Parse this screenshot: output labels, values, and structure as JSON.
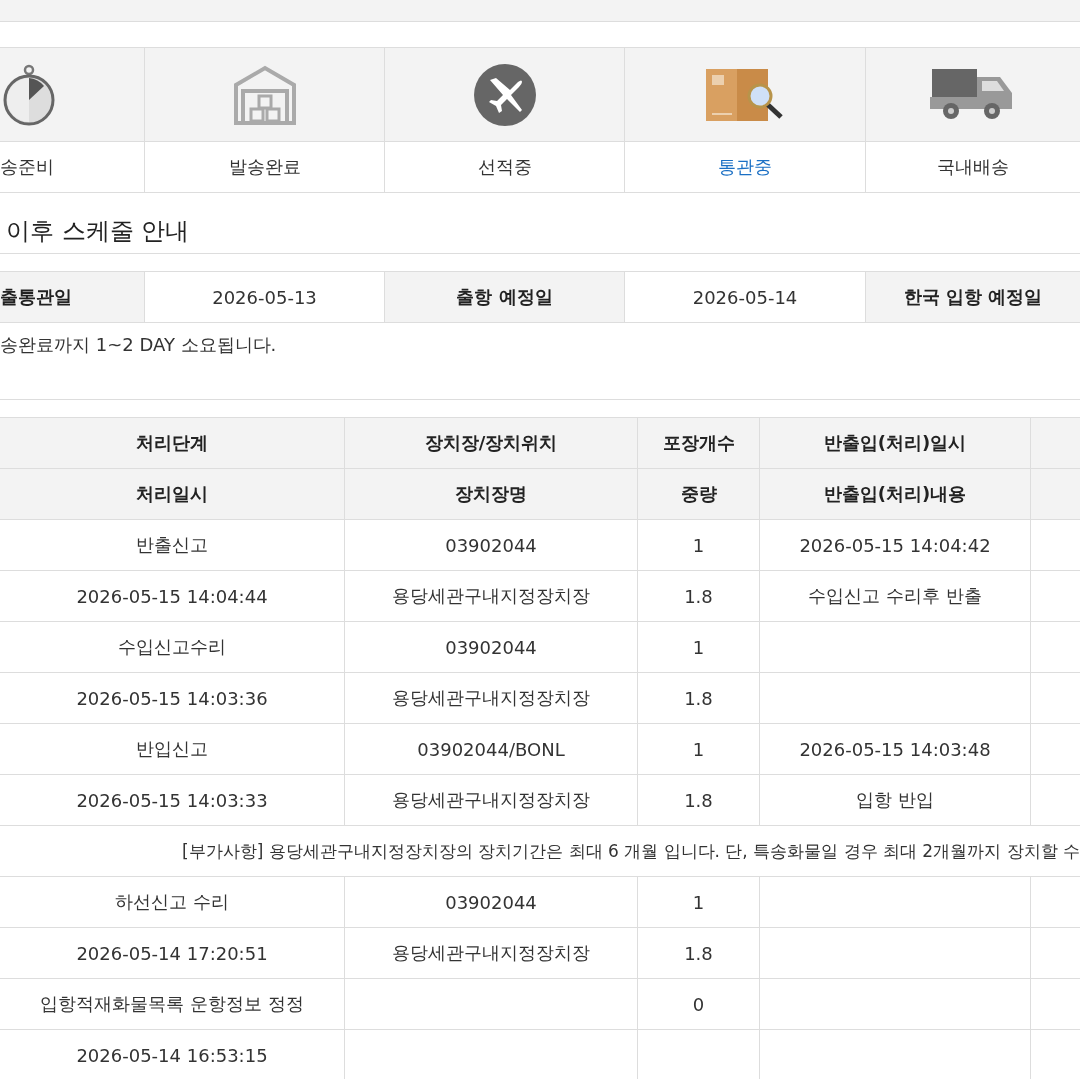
{
  "steps": [
    {
      "label": "송준비",
      "kind": "stopwatch",
      "selected": false
    },
    {
      "label": "발송완료",
      "kind": "warehouse",
      "selected": false
    },
    {
      "label": "선적중",
      "kind": "plane",
      "selected": false
    },
    {
      "label": "통관중",
      "kind": "inspection",
      "selected": true
    },
    {
      "label": "국내배송",
      "kind": "truck",
      "selected": false
    }
  ],
  "schedule": {
    "title": "이후 스케줄 안내",
    "cells": [
      {
        "kind": "label",
        "text": "출통관일"
      },
      {
        "kind": "value",
        "text": "2026-05-13"
      },
      {
        "kind": "label",
        "text": "출항 예정일"
      },
      {
        "kind": "value",
        "text": "2026-05-14"
      },
      {
        "kind": "label",
        "text": "한국 입항 예정일"
      }
    ],
    "note": "송완료까지 1~2 DAY 소요됩니다."
  },
  "table": {
    "header": [
      [
        "처리단계",
        "장치장/장치위치",
        "포장개수",
        "반출입(처리)일시"
      ],
      [
        "처리일시",
        "장치장명",
        "중량",
        "반출입(처리)내용"
      ]
    ],
    "rows": [
      {
        "kind": "record",
        "cells": [
          [
            "반출신고",
            "03902044",
            "1",
            "2026-05-15 14:04:42"
          ],
          [
            "2026-05-15 14:04:44",
            "용당세관구내지정장치장",
            "1.8",
            "수입신고 수리후 반출"
          ]
        ]
      },
      {
        "kind": "record",
        "cells": [
          [
            "수입신고수리",
            "03902044",
            "1",
            ""
          ],
          [
            "2026-05-15 14:03:36",
            "용당세관구내지정장치장",
            "1.8",
            ""
          ]
        ]
      },
      {
        "kind": "record",
        "cells": [
          [
            "반입신고",
            "03902044/BONL",
            "1",
            "2026-05-15 14:03:48"
          ],
          [
            "2026-05-15 14:03:33",
            "용당세관구내지정장치장",
            "1.8",
            "입항 반입"
          ]
        ]
      },
      {
        "kind": "notice",
        "text": "[부가사항] 용당세관구내지정장치장의 장치기간은 최대 6 개월 입니다. 단, 특송화물일 경우 최대 2개월까지 장치할 수"
      },
      {
        "kind": "record",
        "cells": [
          [
            "하선신고 수리",
            "03902044",
            "1",
            ""
          ],
          [
            "2026-05-14 17:20:51",
            "용당세관구내지정장치장",
            "1.8",
            ""
          ]
        ]
      },
      {
        "kind": "record",
        "cells": [
          [
            "입항적재화물목록 운항정보 정정",
            "",
            "0",
            ""
          ],
          [
            "2026-05-14 16:53:15",
            "",
            "",
            ""
          ]
        ]
      }
    ]
  }
}
